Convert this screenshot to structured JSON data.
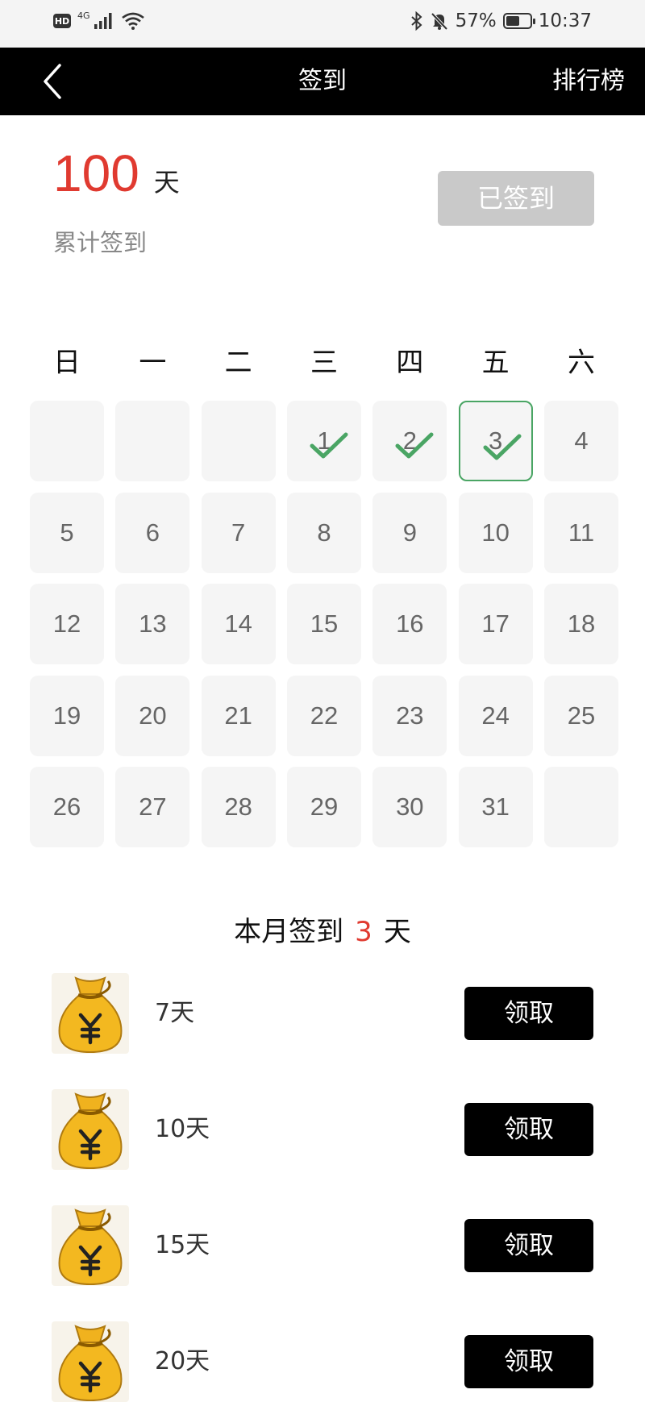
{
  "status_bar": {
    "hd": "HD",
    "signal": "4G",
    "battery": "57%",
    "battery_level": 0.57,
    "time": "10:37"
  },
  "nav": {
    "title": "签到",
    "right_link": "排行榜"
  },
  "summary": {
    "total_days": "100",
    "unit": "天",
    "label": "累计签到",
    "signed_button": "已签到"
  },
  "calendar": {
    "weekdays": [
      "日",
      "一",
      "二",
      "三",
      "四",
      "五",
      "六"
    ],
    "first_weekday_index": 3,
    "days_in_month": 31,
    "checked_days": [
      1,
      2,
      3
    ],
    "today": 3,
    "day_labels": [
      "1",
      "2",
      "3",
      "4",
      "5",
      "6",
      "7",
      "8",
      "9",
      "10",
      "11",
      "12",
      "13",
      "14",
      "15",
      "16",
      "17",
      "18",
      "19",
      "20",
      "21",
      "22",
      "23",
      "24",
      "25",
      "26",
      "27",
      "28",
      "29",
      "30",
      "31"
    ]
  },
  "month_summary": {
    "prefix": "本月签到",
    "count": "3",
    "suffix": "天"
  },
  "rewards": [
    {
      "label": "7天",
      "button": "领取"
    },
    {
      "label": "10天",
      "button": "领取"
    },
    {
      "label": "15天",
      "button": "领取"
    },
    {
      "label": "20天",
      "button": "领取"
    }
  ],
  "colors": {
    "accent_red": "#e03a30",
    "check_green": "#4aa564",
    "nav_bg": "#000000",
    "disabled_button": "#c9c9c9"
  },
  "icons": {
    "back": "chevron-left-icon",
    "check": "checkmark-icon",
    "reward": "money-bag-icon"
  }
}
